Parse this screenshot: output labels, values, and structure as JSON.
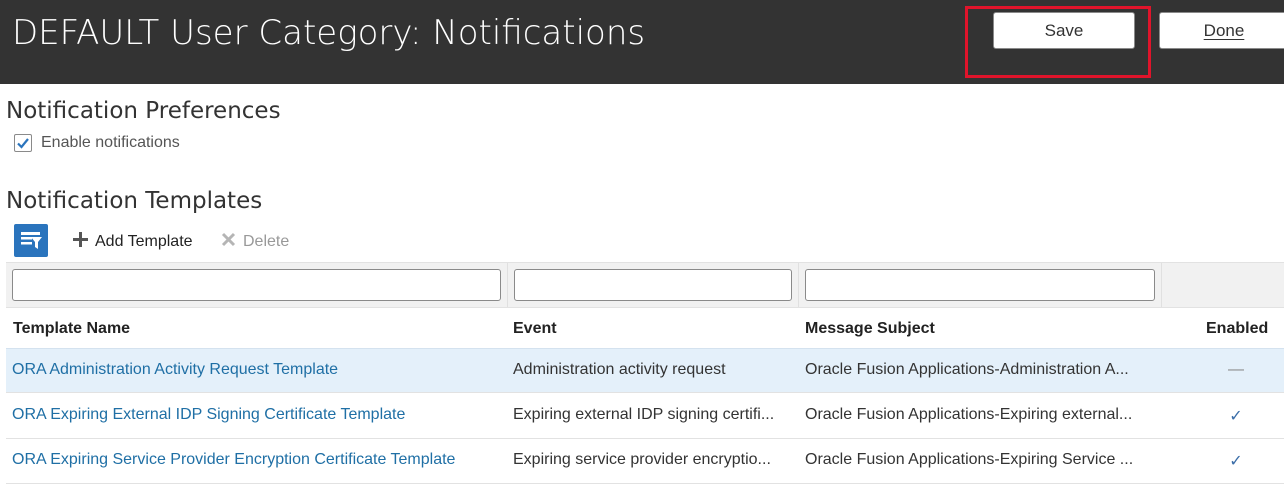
{
  "header": {
    "title": "DEFAULT User Category: Notifications",
    "save_label": "Save",
    "done_label": "Done"
  },
  "preferences": {
    "title": "Notification Preferences",
    "enable_label": "Enable notifications",
    "enable_checked": true
  },
  "templates": {
    "title": "Notification Templates",
    "toolbar": {
      "filter_icon": "query-by-example-icon",
      "add_label": "Add Template",
      "delete_label": "Delete"
    },
    "filters": {
      "name": "",
      "event": "",
      "subject": ""
    },
    "columns": {
      "name": "Template Name",
      "event": "Event",
      "subject": "Message Subject",
      "enabled": "Enabled"
    },
    "rows": [
      {
        "name": "ORA Administration Activity Request Template",
        "event": "Administration activity request",
        "subject": "Oracle Fusion Applications-Administration A...",
        "enabled": "—"
      },
      {
        "name": "ORA Expiring External IDP Signing Certificate Template",
        "event": "Expiring external IDP signing certifi...",
        "subject": "Oracle Fusion Applications-Expiring external...",
        "enabled": "✓"
      },
      {
        "name": "ORA Expiring Service Provider Encryption Certificate Template",
        "event": "Expiring service provider encryptio...",
        "subject": "Oracle Fusion Applications-Expiring Service ...",
        "enabled": "✓"
      }
    ]
  },
  "colors": {
    "header_bg": "#333333",
    "link": "#1f6fa5",
    "highlight": "#e0142b",
    "accent": "#2a74bd",
    "selected_row": "#e4f0fa"
  }
}
